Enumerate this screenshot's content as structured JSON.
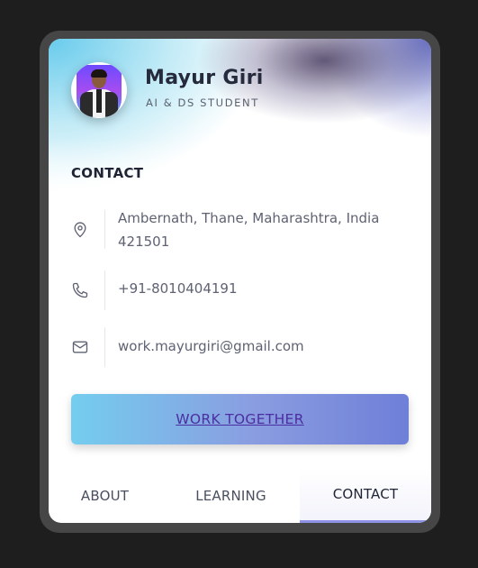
{
  "profile": {
    "name": "Mayur Giri",
    "role": "AI & DS STUDENT"
  },
  "contact": {
    "section_title": "CONTACT",
    "location_line1": "Ambernath, Thane, Maharashtra, India",
    "location_line2": "421501",
    "phone": "+91-8010404191",
    "email": "work.mayurgiri@gmail.com"
  },
  "cta": {
    "label": "WORK TOGETHER"
  },
  "tabs": [
    {
      "label": "ABOUT",
      "active": false
    },
    {
      "label": "LEARNING",
      "active": false
    },
    {
      "label": "CONTACT",
      "active": true
    }
  ],
  "icons": {
    "location": "map-pin-icon",
    "phone": "phone-icon",
    "email": "mail-icon"
  },
  "colors": {
    "accent": "#6e7fd8",
    "cta_text": "#4b2fa0",
    "active_tab_indicator": "#8e92e4"
  }
}
